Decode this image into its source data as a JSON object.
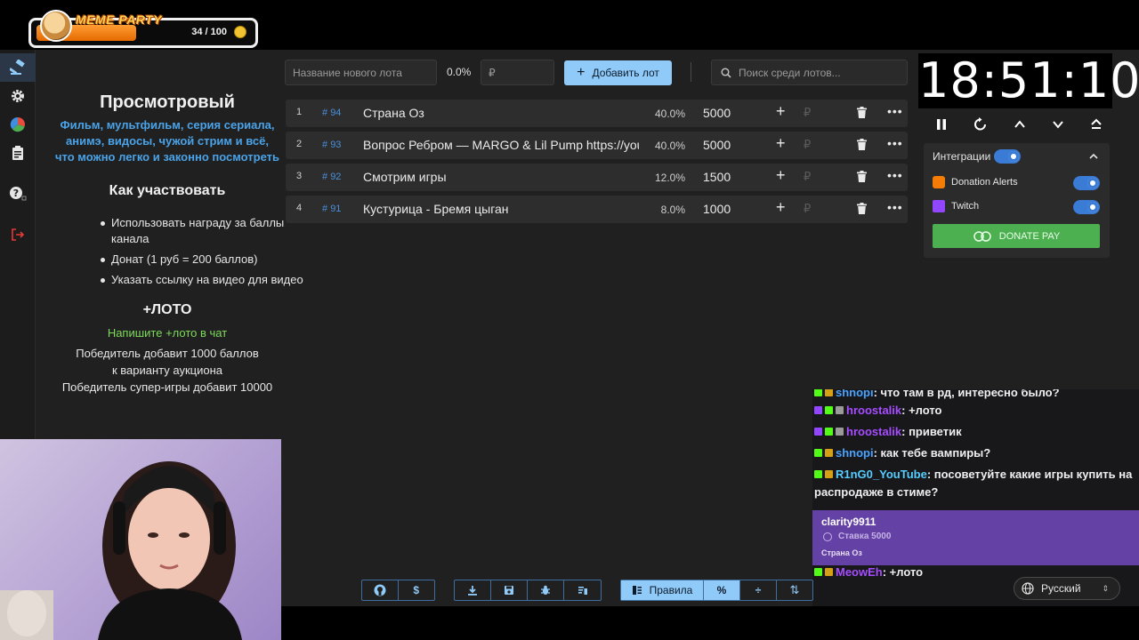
{
  "overlay": {
    "title": "MEME PARTY",
    "progress_text": "34 / 100",
    "progress_fraction": 0.34
  },
  "rules": {
    "title": "Просмотровый",
    "description_lines": [
      "Фильм, мультфильм, серия сериала,",
      "анимэ, видосы, чужой стрим и всё,",
      "что можно легко и законно посмотреть"
    ],
    "participate_title": "Как участвовать",
    "participate_items": [
      "Использовать награду за баллы канала",
      "Донат (1 руб = 200 баллов)",
      "Указать ссылку на видео для видео"
    ],
    "loto_title": "+ЛОТО",
    "loto_hint": "Напишите +лото в чат",
    "loto_text_1": "Победитель добавит 1000 баллов к варианту аукциона",
    "loto_text_2": "Победитель супер-игры добавит 10000"
  },
  "controls": {
    "new_lot_placeholder": "Название нового лота",
    "percent": "0.0%",
    "currency_placeholder": "₽",
    "add_label": "Добавить лот",
    "search_placeholder": "Поиск среди лотов..."
  },
  "lots": [
    {
      "index": "1",
      "id": "94",
      "name": "Страна Оз",
      "share": "40.0%",
      "amount": "5000"
    },
    {
      "index": "2",
      "id": "93",
      "name": "Вопрос Ребром — MARGO & Lil Pump https://youtu",
      "share": "40.0%",
      "amount": "5000"
    },
    {
      "index": "3",
      "id": "92",
      "name": "Смотрим игры",
      "share": "12.0%",
      "amount": "1500"
    },
    {
      "index": "4",
      "id": "91",
      "name": "Кустурица - Бремя цыган",
      "share": "8.0%",
      "amount": "1000"
    }
  ],
  "lot_currency": "₽",
  "timer": {
    "time": "18:51:10"
  },
  "integrations": {
    "title": "Интеграции",
    "items": [
      {
        "name": "Donation Alerts",
        "enabled": true
      },
      {
        "name": "Twitch",
        "enabled": true
      }
    ],
    "donate_pay": "DONATE PAY"
  },
  "chat": {
    "messages": [
      {
        "user": "shnopi",
        "text": ": что там в рд, интересно было?",
        "user_color": "#4aa3ff"
      },
      {
        "user": "hroostalik",
        "text": ": +лото",
        "user_color": "#a64dff"
      },
      {
        "user": "hroostalik",
        "text": ": приветик",
        "user_color": "#a64dff"
      },
      {
        "user": "shnopi",
        "text": ": как тебе вампиры?",
        "user_color": "#4aa3ff"
      },
      {
        "user": "R1nG0_YouTube",
        "text": ": посоветуйте какие игры купить на распродаже в стиме?",
        "user_color": "#55ccff"
      },
      {
        "user": "MeowEh",
        "text": ": +лото",
        "user_color": "#a64dff"
      }
    ],
    "highlight": {
      "user": "clarity9911",
      "bet": "Ставка 5000",
      "lot": "Страна Оз"
    }
  },
  "footer": {
    "rules_label": "Правила",
    "language": "Русский"
  },
  "colors": {
    "accent": "#90caf9",
    "lot_bg": "#2d2d2d",
    "app_bg": "#202020",
    "donate_pay": "#4caf50",
    "chat_highlight": "#6441a5"
  }
}
